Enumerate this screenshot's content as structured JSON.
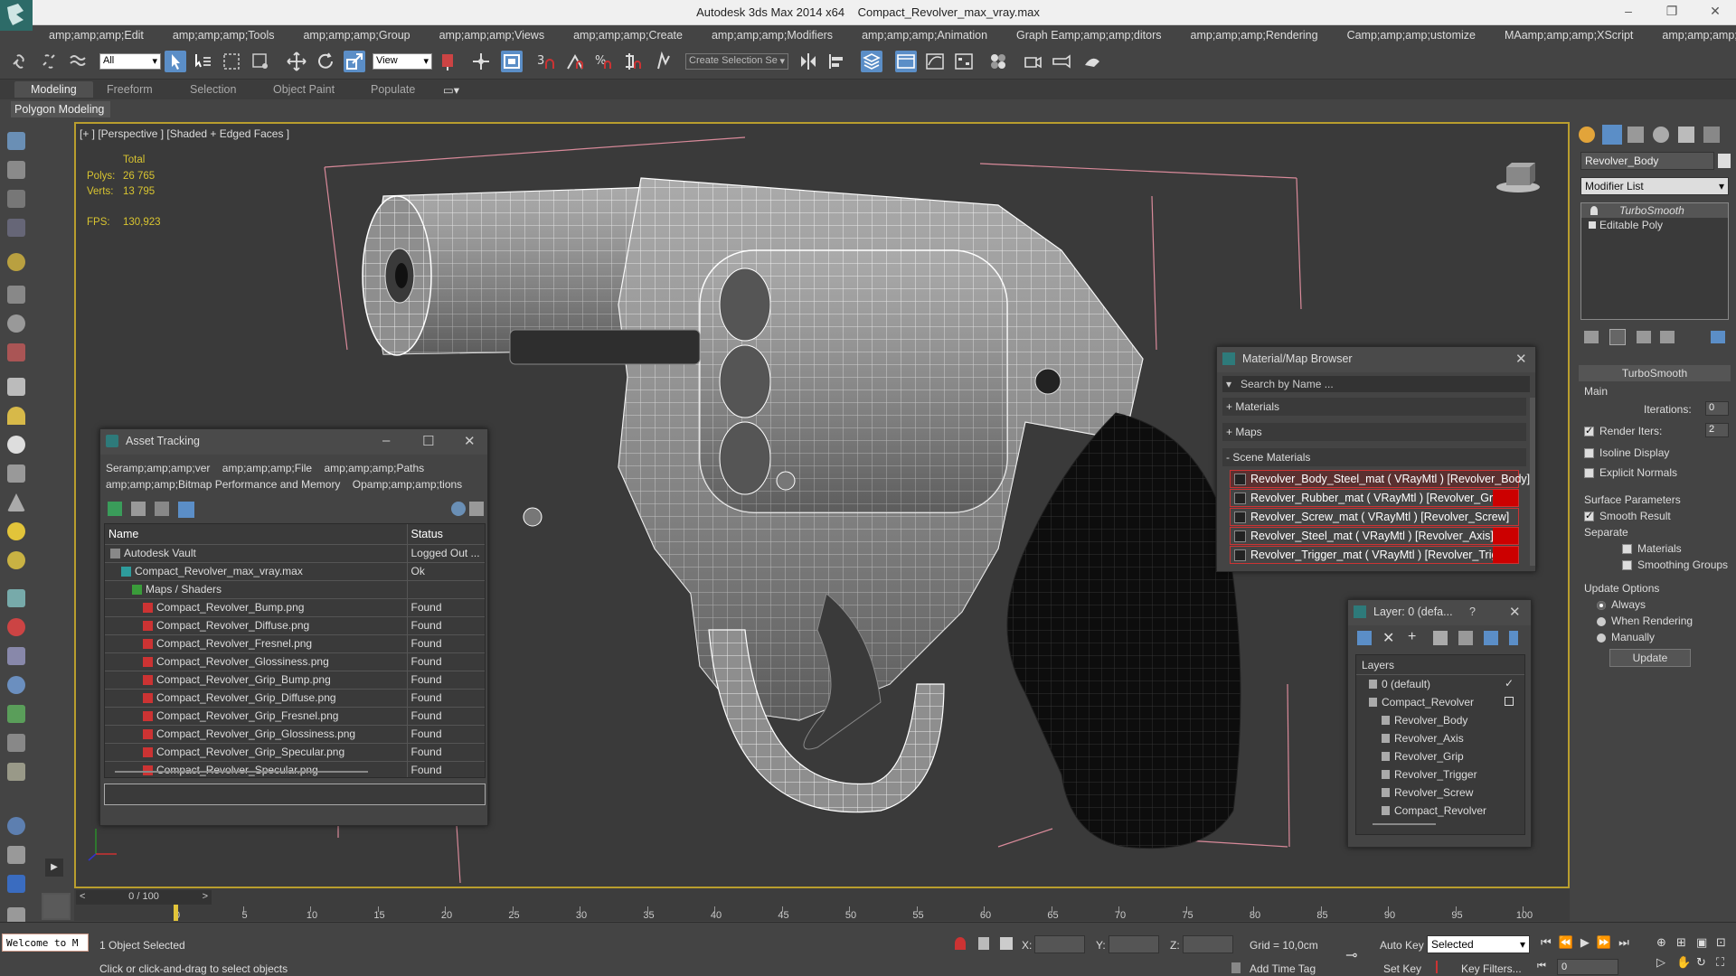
{
  "window": {
    "app_title": "Autodesk 3ds Max  2014 x64",
    "file_title": "Compact_Revolver_max_vray.max"
  },
  "menu": [
    "amp;amp;amp;Edit",
    "amp;amp;amp;Tools",
    "amp;amp;amp;Group",
    "amp;amp;amp;Views",
    "amp;amp;amp;Create",
    "amp;amp;amp;Modifiers",
    "amp;amp;amp;Animation",
    "Graph Eamp;amp;amp;ditors",
    "amp;amp;amp;Rendering",
    "Camp;amp;amp;ustomize",
    "MAamp;amp;amp;XScript",
    "amp;amp;amp;Help"
  ],
  "toolbar": {
    "selection_filter": "All",
    "ref_coord": "View",
    "selection_set_placeholder": "Create Selection Se"
  },
  "ribbon": {
    "tabs": [
      "Modeling",
      "Freeform",
      "Selection",
      "Object Paint",
      "Populate"
    ],
    "sub": "Polygon Modeling"
  },
  "viewport": {
    "label": "[+ ] [Perspective ] [Shaded + Edged Faces ]",
    "stats_total": "Total",
    "polys_label": "Polys:",
    "polys_value": "26 765",
    "verts_label": "Verts:",
    "verts_value": "13 795",
    "fps_label": "FPS:",
    "fps_value": "130,923"
  },
  "asset_tracking": {
    "title": "Asset Tracking",
    "menu": [
      "Seramp;amp;amp;ver",
      "amp;amp;amp;File",
      "amp;amp;amp;Paths",
      "amp;amp;amp;Bitmap Performance and Memory",
      "Opamp;amp;amp;tions"
    ],
    "col_name": "Name",
    "col_status": "Status",
    "rows": [
      {
        "name": "Autodesk Vault",
        "status": "Logged Out ...",
        "indent": 0
      },
      {
        "name": "Compact_Revolver_max_vray.max",
        "status": "Ok",
        "indent": 1
      },
      {
        "name": "Maps / Shaders",
        "status": "",
        "indent": 2
      },
      {
        "name": "Compact_Revolver_Bump.png",
        "status": "Found",
        "indent": 3
      },
      {
        "name": "Compact_Revolver_Diffuse.png",
        "status": "Found",
        "indent": 3
      },
      {
        "name": "Compact_Revolver_Fresnel.png",
        "status": "Found",
        "indent": 3
      },
      {
        "name": "Compact_Revolver_Glossiness.png",
        "status": "Found",
        "indent": 3
      },
      {
        "name": "Compact_Revolver_Grip_Bump.png",
        "status": "Found",
        "indent": 3
      },
      {
        "name": "Compact_Revolver_Grip_Diffuse.png",
        "status": "Found",
        "indent": 3
      },
      {
        "name": "Compact_Revolver_Grip_Fresnel.png",
        "status": "Found",
        "indent": 3
      },
      {
        "name": "Compact_Revolver_Grip_Glossiness.png",
        "status": "Found",
        "indent": 3
      },
      {
        "name": "Compact_Revolver_Grip_Specular.png",
        "status": "Found",
        "indent": 3
      },
      {
        "name": "Compact_Revolver_Specular.png",
        "status": "Found",
        "indent": 3
      }
    ]
  },
  "material_browser": {
    "title": "Material/Map Browser",
    "search_placeholder": "Search by Name ...",
    "sections": [
      "+ Materials",
      "+ Maps",
      "- Scene Materials"
    ],
    "materials": [
      "Revolver_Body_Steel_mat ( VRayMtl ) [Revolver_Body]",
      "Revolver_Rubber_mat ( VRayMtl ) [Revolver_Grip]",
      "Revolver_Screw_mat ( VRayMtl ) [Revolver_Screw]",
      "Revolver_Steel_mat ( VRayMtl ) [Revolver_Axis]",
      "Revolver_Trigger_mat ( VRayMtl ) [Revolver_Trigger]"
    ]
  },
  "layer_panel": {
    "title": "Layer: 0 (defa...",
    "help": "?",
    "header": "Layers",
    "items": [
      {
        "name": "0 (default)",
        "indent": 0
      },
      {
        "name": "Compact_Revolver",
        "indent": 0
      },
      {
        "name": "Revolver_Body",
        "indent": 1
      },
      {
        "name": "Revolver_Axis",
        "indent": 1
      },
      {
        "name": "Revolver_Grip",
        "indent": 1
      },
      {
        "name": "Revolver_Trigger",
        "indent": 1
      },
      {
        "name": "Revolver_Screw",
        "indent": 1
      },
      {
        "name": "Compact_Revolver",
        "indent": 1
      }
    ]
  },
  "command_panel": {
    "object_name": "Revolver_Body",
    "modifier_list": "Modifier List",
    "stack": [
      "TurboSmooth",
      "Editable Poly"
    ],
    "rollout_title": "TurboSmooth",
    "main": "Main",
    "iterations_label": "Iterations:",
    "iterations_value": "0",
    "render_iters_label": "Render Iters:",
    "render_iters_value": "2",
    "isoline": "Isoline Display",
    "explicit_normals": "Explicit Normals",
    "surface_params": "Surface Parameters",
    "smooth_result": "Smooth Result",
    "separate": "Separate",
    "materials": "Materials",
    "smoothing_groups": "Smoothing Groups",
    "update_options": "Update Options",
    "always": "Always",
    "when_rendering": "When Rendering",
    "manually": "Manually",
    "update_btn": "Update"
  },
  "timeline": {
    "frame": "0 / 100",
    "ticks": [
      "0",
      "5",
      "10",
      "15",
      "20",
      "25",
      "30",
      "35",
      "40",
      "45",
      "50",
      "55",
      "60",
      "65",
      "70",
      "75",
      "80",
      "85",
      "90",
      "95",
      "100"
    ]
  },
  "status": {
    "maxscript": "Welcome to M",
    "selected": "1 Object Selected",
    "prompt": "Click or click-and-drag to select objects",
    "x_label": "X:",
    "y_label": "Y:",
    "z_label": "Z:",
    "grid": "Grid = 10,0cm",
    "add_time_tag": "Add Time Tag",
    "auto_key": "Auto Key",
    "set_key": "Set Key",
    "selected_dd": "Selected",
    "key_filters": "Key Filters...",
    "frame_field": "0"
  },
  "colors": {
    "viewport_border": "#b99e2e",
    "stats": "#d8c430",
    "material_highlight": "#cc0000"
  }
}
